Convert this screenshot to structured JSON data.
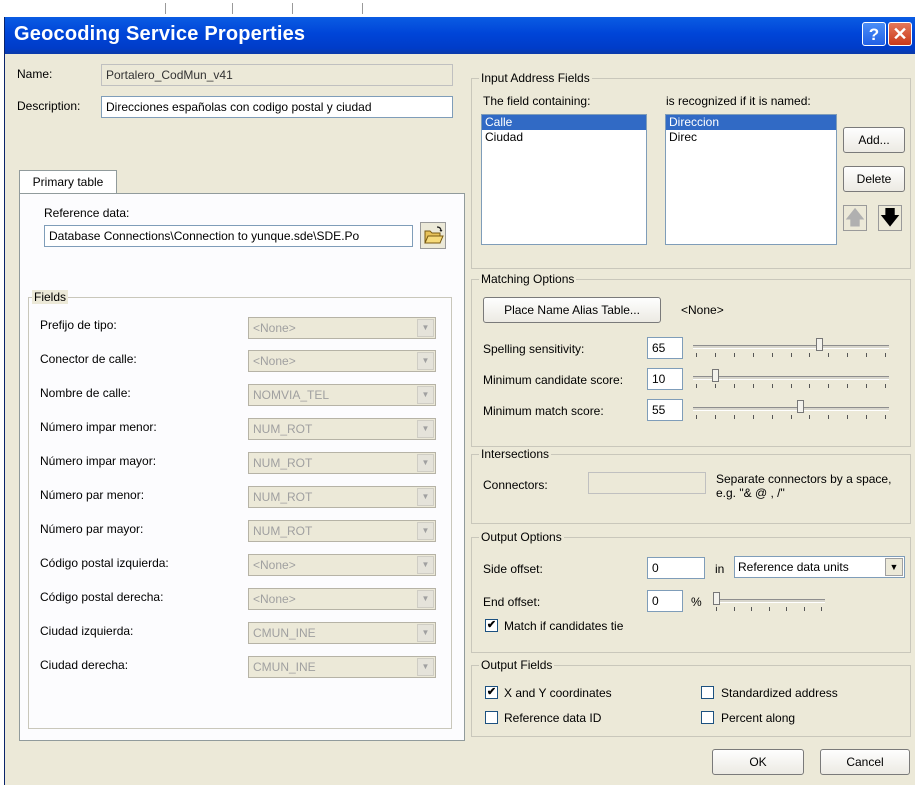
{
  "window": {
    "title": "Geocoding Service Properties",
    "help_glyph": "?",
    "close_glyph": "✕"
  },
  "general": {
    "name_label": "Name:",
    "name_value": "Portalero_CodMun_v41",
    "description_label": "Description:",
    "description_value": "Direcciones españolas con codigo postal y ciudad"
  },
  "primary_tab": {
    "tab_label": "Primary table",
    "reference_label": "Reference data:",
    "reference_value": "Database Connections\\Connection to yunque.sde\\SDE.Po"
  },
  "fields": {
    "group_label": "Fields",
    "rows": [
      {
        "label": "Prefijo de tipo:",
        "value": "<None>"
      },
      {
        "label": "Conector de calle:",
        "value": "<None>"
      },
      {
        "label": "Nombre de calle:",
        "value": "NOMVIA_TEL"
      },
      {
        "label": "Número impar menor:",
        "value": "NUM_ROT"
      },
      {
        "label": "Número impar mayor:",
        "value": "NUM_ROT"
      },
      {
        "label": "Número par menor:",
        "value": "NUM_ROT"
      },
      {
        "label": "Número par mayor:",
        "value": "NUM_ROT"
      },
      {
        "label": "Código postal izquierda:",
        "value": "<None>"
      },
      {
        "label": "Código postal derecha:",
        "value": "<None>"
      },
      {
        "label": "Ciudad izquierda:",
        "value": "CMUN_INE"
      },
      {
        "label": "Ciudad derecha:",
        "value": "CMUN_INE"
      }
    ]
  },
  "input_address": {
    "group_label": "Input Address Fields",
    "left_header": "The field containing:",
    "right_header": "is recognized if it is named:",
    "left_items": [
      "Calle",
      "Ciudad"
    ],
    "right_items": [
      "Direccion",
      "Direc"
    ],
    "add_label": "Add...",
    "delete_label": "Delete",
    "up_glyph": "🡅",
    "down_glyph": "🡇"
  },
  "matching": {
    "group_label": "Matching Options",
    "alias_button": "Place Name Alias Table...",
    "alias_value": "<None>",
    "spelling_label": "Spelling sensitivity:",
    "spelling_value": "65",
    "candidate_label": "Minimum candidate score:",
    "candidate_value": "10",
    "match_label": "Minimum match score:",
    "match_value": "55",
    "slider_levels": [
      65,
      10,
      55
    ]
  },
  "intersections": {
    "group_label": "Intersections",
    "connectors_label": "Connectors:",
    "connectors_value": "",
    "hint": "Separate connectors by a space, e.g. \"& @ , /\""
  },
  "output_options": {
    "group_label": "Output Options",
    "side_label": "Side offset:",
    "side_value": "0",
    "in_label": "in",
    "units_value": "Reference data units",
    "end_label": "End offset:",
    "end_value": "0",
    "percent_label": "%",
    "end_slider_level": 0,
    "tie_label": "Match if candidates tie",
    "tie_checked": "✔"
  },
  "output_fields": {
    "group_label": "Output Fields",
    "xy_label": "X and Y coordinates",
    "xy_checked": "✔",
    "refid_label": "Reference data ID",
    "std_label": "Standardized address",
    "pct_label": "Percent along"
  },
  "footer": {
    "ok_label": "OK",
    "cancel_label": "Cancel"
  },
  "colors": {
    "title_bar": "#0045d8",
    "selection": "#316ac5",
    "dialog_bg": "#ece9d8"
  }
}
